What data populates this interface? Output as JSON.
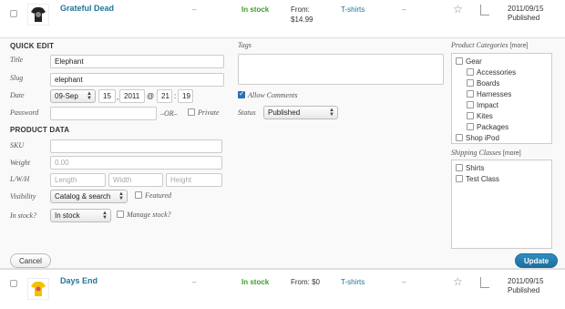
{
  "rows": [
    {
      "name": "Grateful Dead",
      "sku": "–",
      "stock": "In stock",
      "price_prefix": "From:",
      "price": "$14.99",
      "category": "T-shirts",
      "tags": "–",
      "date": "2011/09/15",
      "status": "Published"
    },
    {
      "name": "Days End",
      "sku": "–",
      "stock": "In stock",
      "price_prefix": "From: $0",
      "price": "",
      "category": "T-shirts",
      "tags": "–",
      "date": "2011/09/15",
      "status": "Published"
    }
  ],
  "quick_edit": {
    "heading": "QUICK EDIT",
    "title_label": "Title",
    "title_value": "Elephant",
    "slug_label": "Slug",
    "slug_value": "elephant",
    "date_label": "Date",
    "month": "09-Sep",
    "day": "15",
    "year": "2011",
    "at": "@",
    "hour": "21",
    "colon": ":",
    "minute": "19",
    "password_label": "Password",
    "or": "–OR–",
    "private_label": "Private",
    "tags_label": "Tags",
    "allow_comments_label": "Allow Comments",
    "status_label": "Status",
    "status_value": "Published",
    "product_categories_label": "Product Categories",
    "more": "[more]",
    "categories": [
      "Gear",
      "Accessories",
      "Boards",
      "Harnesses",
      "Impact",
      "Kites",
      "Packages",
      "Shop iPod"
    ],
    "shipping_classes_label": "Shipping Classes",
    "shipping_classes": [
      "Shirts",
      "Test Class"
    ]
  },
  "product_data": {
    "heading": "PRODUCT DATA",
    "sku_label": "SKU",
    "weight_label": "Weight",
    "weight_placeholder": "0.00",
    "lwh_label": "L/W/H",
    "length_placeholder": "Length",
    "width_placeholder": "Width",
    "height_placeholder": "Height",
    "visibility_label": "Visibility",
    "visibility_value": "Catalog & search",
    "featured_label": "Featured",
    "in_stock_label": "In stock?",
    "in_stock_value": "In stock",
    "manage_stock_label": "Manage stock?"
  },
  "buttons": {
    "cancel": "Cancel",
    "update": "Update"
  },
  "icons": {
    "featured": "star-icon",
    "product_type": "simple-product-icon",
    "thumb1": "tshirt-black-icon",
    "thumb2": "tshirt-yellow-icon"
  },
  "colors": {
    "link": "#21759b",
    "in_stock": "#3e9d2b",
    "update_button": "#2b85b8"
  }
}
